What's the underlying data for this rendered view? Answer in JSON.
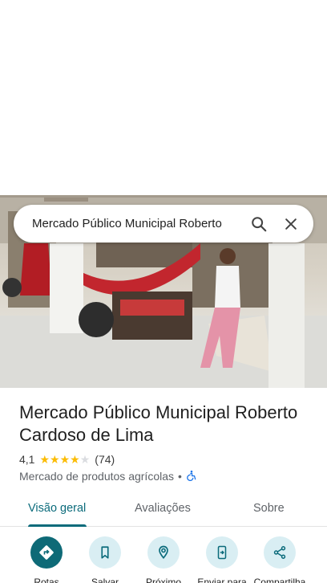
{
  "search": {
    "query": "Mercado Público Municipal Roberto"
  },
  "place": {
    "name": "Mercado Público Municipal Roberto Cardoso de Lima",
    "rating": "4,1",
    "stars": 4.1,
    "review_count": "(74)",
    "category": "Mercado de produtos agrícolas",
    "separator": "•"
  },
  "tabs": [
    {
      "label": "Visão geral",
      "active": true
    },
    {
      "label": "Avaliações",
      "active": false
    },
    {
      "label": "Sobre",
      "active": false
    }
  ],
  "actions": [
    {
      "label": "Rotas",
      "icon": "directions-icon"
    },
    {
      "label": "Salvar",
      "icon": "bookmark-icon"
    },
    {
      "label": "Próximo",
      "icon": "nearby-icon"
    },
    {
      "label": "Enviar para",
      "icon": "send-to-phone-icon"
    },
    {
      "label": "Compartilha",
      "icon": "share-icon"
    }
  ],
  "colors": {
    "accent": "#0b6b7b",
    "star": "#fbbc04",
    "star_empty": "#dadce0",
    "action_bg": "#d9eef3",
    "action_primary_bg": "#0e6a77",
    "accessibility": "#1a73e8"
  }
}
